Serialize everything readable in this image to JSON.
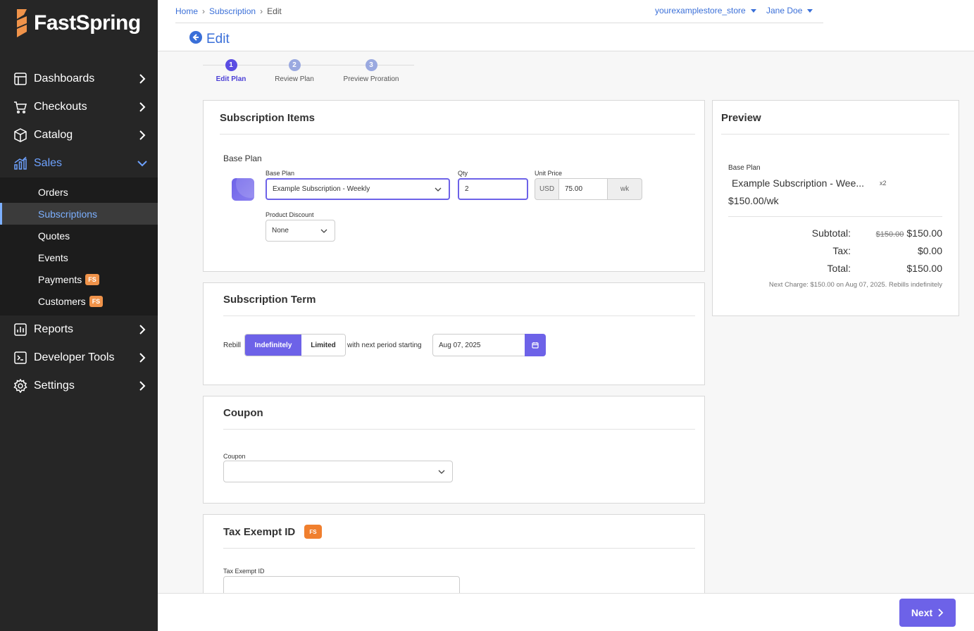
{
  "app": {
    "logo_text": "FastSpring"
  },
  "sidebar": {
    "items": [
      {
        "label": "Dashboards",
        "icon": "dashboard-icon"
      },
      {
        "label": "Checkouts",
        "icon": "cart-icon"
      },
      {
        "label": "Catalog",
        "icon": "box-icon"
      },
      {
        "label": "Sales",
        "icon": "chart-icon"
      },
      {
        "label": "Reports",
        "icon": "report-icon"
      },
      {
        "label": "Developer Tools",
        "icon": "terminal-icon"
      },
      {
        "label": "Settings",
        "icon": "gear-icon"
      }
    ],
    "sales_sub": [
      {
        "label": "Orders"
      },
      {
        "label": "Subscriptions"
      },
      {
        "label": "Quotes"
      },
      {
        "label": "Events"
      },
      {
        "label": "Payments",
        "badge": "FS"
      },
      {
        "label": "Customers",
        "badge": "FS"
      }
    ]
  },
  "header": {
    "breadcrumb": [
      "Home",
      "Subscription",
      "Edit"
    ],
    "store": "yourexamplestore_store",
    "user": "Jane Doe",
    "title": "Edit"
  },
  "stepper": [
    {
      "num": "1",
      "label": "Edit Plan"
    },
    {
      "num": "2",
      "label": "Review Plan"
    },
    {
      "num": "3",
      "label": "Preview Proration"
    }
  ],
  "items_card": {
    "title": "Subscription Items",
    "section_label": "Base Plan",
    "base_plan_label": "Base Plan",
    "base_plan_value": "Example Subscription - Weekly",
    "qty_label": "Qty",
    "qty_value": "2",
    "unit_price_label": "Unit Price",
    "currency": "USD",
    "unit_price_value": "75.00",
    "period": "wk",
    "discount_label": "Product Discount",
    "discount_value": "None"
  },
  "term_card": {
    "title": "Subscription Term",
    "rebill_label": "Rebill",
    "opt_indefinitely": "Indefinitely",
    "opt_limited": "Limited",
    "next_period_label": "with next period starting",
    "date_value": "Aug 07, 2025"
  },
  "coupon_card": {
    "title": "Coupon",
    "field_label": "Coupon",
    "field_value": ""
  },
  "tax_card": {
    "title": "Tax Exempt ID",
    "badge": "FS",
    "field_label": "Tax Exempt ID",
    "field_value": ""
  },
  "preview": {
    "title": "Preview",
    "plan_label": "Base Plan",
    "plan_name": "Example Subscription - Wee...",
    "plan_qty": "x2",
    "plan_price": "$150.00/wk",
    "subtotal_label": "Subtotal:",
    "subtotal_original": "$150.00",
    "subtotal_value": "$150.00",
    "tax_label": "Tax:",
    "tax_value": "$0.00",
    "total_label": "Total:",
    "total_value": "$150.00",
    "next_charge": "Next Charge: $150.00 on Aug 07, 2025. Rebills indefinitely"
  },
  "footer": {
    "next_label": "Next"
  },
  "colors": {
    "accent": "#6d62e8",
    "link": "#3a6fd8",
    "sidebar_bg": "#262626",
    "badge_orange": "#f07f2e"
  }
}
